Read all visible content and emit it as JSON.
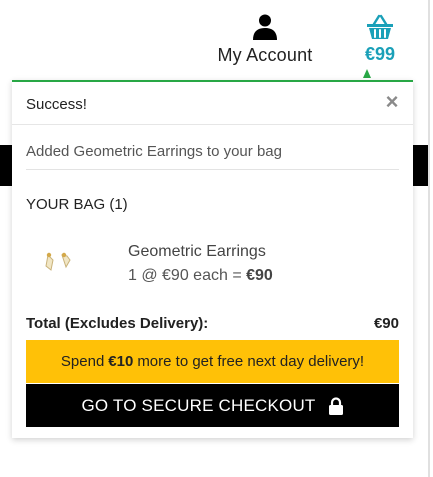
{
  "header": {
    "account_label": "My Account",
    "account_icon": "user-icon",
    "basket_icon": "basket-icon",
    "basket_total": "€99"
  },
  "toast": {
    "title": "Success!",
    "close_symbol": "×",
    "added_message": "Added Geometric Earrings to your bag",
    "bag_heading": "YOUR BAG (1)",
    "item": {
      "name": "Geometric Earrings",
      "price_prefix": "1 @ €90 each = ",
      "line_total": "€90"
    },
    "total_label": "Total (Excludes Delivery):",
    "total_value": "€90",
    "promo": {
      "before": "Spend",
      "amount": "€10",
      "after": "more to get free next day delivery!"
    },
    "checkout_label": "GO TO SECURE CHECKOUT",
    "checkout_icon": "lock-icon"
  },
  "colors": {
    "accent_teal": "#1aa0b8",
    "success_green": "#28a745",
    "promo_yellow": "#ffc107",
    "checkout_black": "#000000"
  }
}
